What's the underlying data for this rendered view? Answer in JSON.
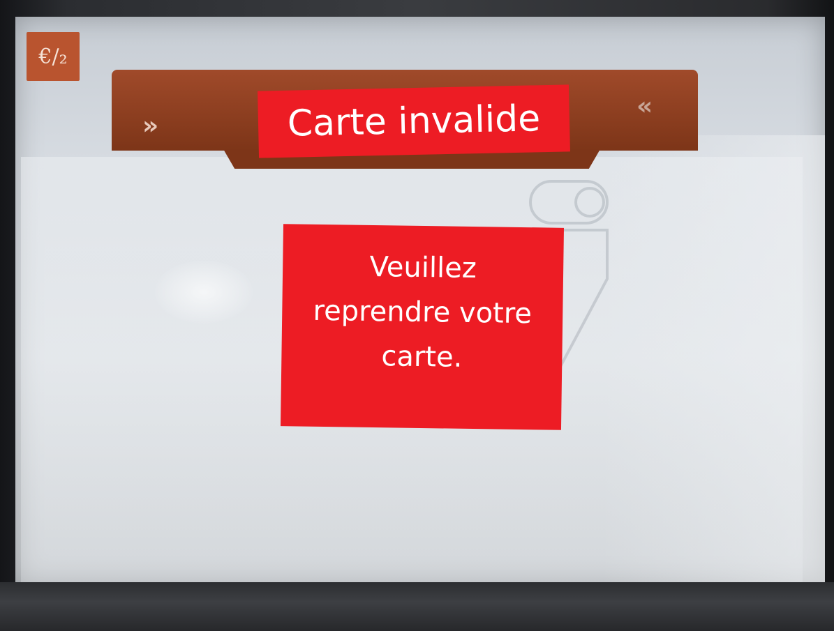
{
  "screen": {
    "logo_glyph": "€/₂",
    "title": "Carte invalide",
    "nav_left_glyph": "»",
    "nav_right_glyph": "«",
    "message": "Veuillez\nreprendre votre\ncarte."
  },
  "colors": {
    "highlight_red": "#ed1c24",
    "header_brown": "#8a3d20",
    "logo_tile": "#b9542f"
  },
  "icons": {
    "logo": "euro-logo-icon",
    "left": "double-chevron-right-icon",
    "right": "double-chevron-left-icon",
    "illustration": "card-slot-illustration"
  }
}
